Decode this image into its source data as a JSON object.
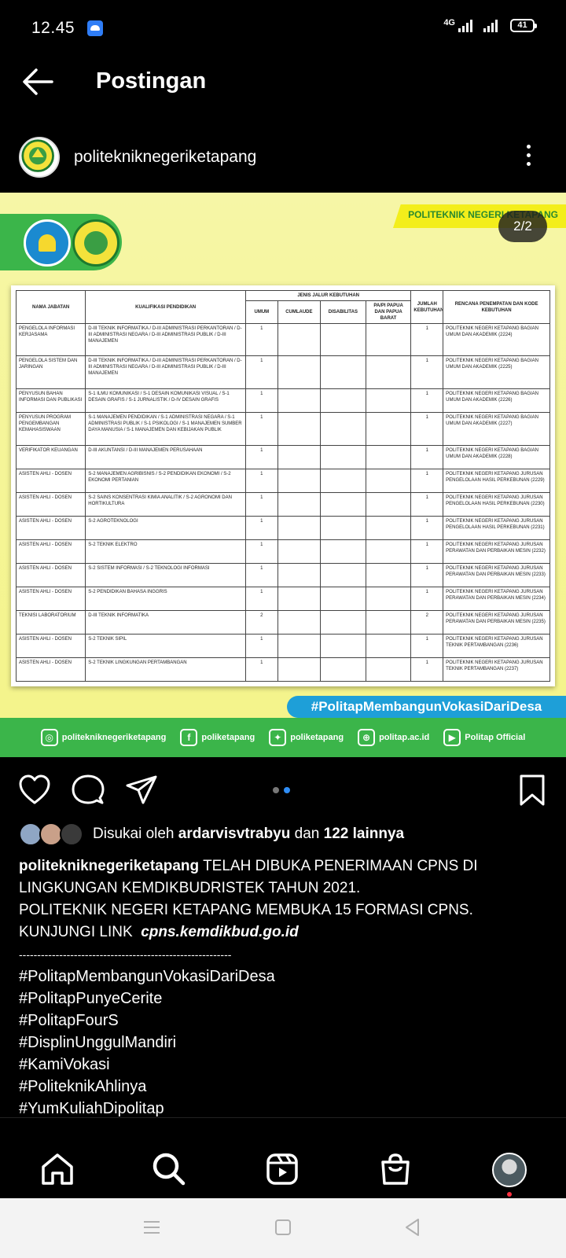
{
  "status_bar": {
    "time": "12.45",
    "network": "4G",
    "battery": "41"
  },
  "header": {
    "title": "Postingan"
  },
  "account": {
    "username": "politekniknegeriketapang"
  },
  "post": {
    "brand_label": "POLITEKNIK NEGERI KETAPANG",
    "page_counter": "2/2",
    "hashtag_banner": "#PolitapMembangunVokasiDariDesa",
    "social_links": [
      {
        "icon": "instagram-icon",
        "glyph": "◎",
        "label": "politekniknegeriketapang"
      },
      {
        "icon": "facebook-icon",
        "glyph": "f",
        "label": "poliketapang"
      },
      {
        "icon": "twitter-icon",
        "glyph": "✦",
        "label": "poliketapang"
      },
      {
        "icon": "globe-icon",
        "glyph": "⊕",
        "label": "politap.ac.id"
      },
      {
        "icon": "youtube-icon",
        "glyph": "▶",
        "label": "Politap Official"
      }
    ],
    "table": {
      "headers": {
        "jabatan": "NAMA JABATAN",
        "kualifikasi": "KUALIFIKASI PENDIDIKAN",
        "jenis": "JENIS JALUR KEBUTUHAN",
        "umum": "UMUM",
        "cumlaude": "CUMLAUDE",
        "disabilitas": "DISABILITAS",
        "papua": "PA/PI PAPUA DAN PAPUA BARAT",
        "jumlah": "JUMLAH KEBUTUHAN",
        "rencana": "RENCANA PENEMPATAN DAN KODE KEBUTUHAN"
      },
      "rows": [
        {
          "jabatan": "PENGELOLA INFORMASI KERJASAMA",
          "kualifikasi": "D-III TEKNIK INFORMATIKA / D-III ADMINISTRASI PERKANTORAN / D-III ADMINISTRASI NEGARA / D-III ADMINISTRASI PUBLIK / D-III MANAJEMEN",
          "umum": "1",
          "jumlah": "1",
          "rencana": "POLITEKNIK NEGERI KETAPANG BAGIAN UMUM DAN AKADEMIK (2224)"
        },
        {
          "jabatan": "PENGELOLA SISTEM DAN JARINGAN",
          "kualifikasi": "D-III TEKNIK INFORMATIKA / D-III ADMINISTRASI PERKANTORAN / D-III ADMINISTRASI NEGARA / D-III ADMINISTRASI PUBLIK / D-III MANAJEMEN",
          "umum": "1",
          "jumlah": "1",
          "rencana": "POLITEKNIK NEGERI KETAPANG BAGIAN UMUM DAN AKADEMIK (2225)"
        },
        {
          "jabatan": "PENYUSUN BAHAN INFORMASI DAN PUBLIKASI",
          "kualifikasi": "S-1 ILMU KOMUNIKASI / S-1 DESAIN KOMUNIKASI VISUAL / S-1 DESAIN GRAFIS / S-1 JURNALISTIK / D-IV DESAIN GRAFIS",
          "umum": "1",
          "jumlah": "1",
          "rencana": "POLITEKNIK NEGERI KETAPANG BAGIAN UMUM DAN AKADEMIK (2226)"
        },
        {
          "jabatan": "PENYUSUN PROGRAM PENGEMBANGAN KEMAHASISWAAN",
          "kualifikasi": "S-1 MANAJEMEN PENDIDIKAN / S-1 ADMINISTRASI NEGARA / S-1 ADMINISTRASI PUBLIK / S-1 PSIKOLOGI / S-1 MANAJEMEN SUMBER DAYA MANUSIA / S-1 MANAJEMEN DAN KEBIJAKAN PUBLIK",
          "umum": "1",
          "jumlah": "1",
          "rencana": "POLITEKNIK NEGERI KETAPANG BAGIAN UMUM DAN AKADEMIK (2227)"
        },
        {
          "jabatan": "VERIFIKATOR KEUANGAN",
          "kualifikasi": "D-III AKUNTANSI / D-III MANAJEMEN PERUSAHAAN",
          "umum": "1",
          "jumlah": "1",
          "rencana": "POLITEKNIK NEGERI KETAPANG BAGIAN UMUM DAN AKADEMIK (2228)"
        },
        {
          "jabatan": "ASISTEN AHLI - DOSEN",
          "kualifikasi": "S-2 MANAJEMEN AGRIBISNIS / S-2 PENDIDIKAN EKONOMI / S-2 EKONOMI PERTANIAN",
          "umum": "1",
          "jumlah": "1",
          "rencana": "POLITEKNIK NEGERI KETAPANG JURUSAN PENGELOLAAN HASIL PERKEBUNAN (2229)"
        },
        {
          "jabatan": "ASISTEN AHLI - DOSEN",
          "kualifikasi": "S-2 SAINS KONSENTRASI KIMIA ANALITIK / S-2 AGRONOMI DAN HORTIKULTURA",
          "umum": "1",
          "jumlah": "1",
          "rencana": "POLITEKNIK NEGERI KETAPANG JURUSAN PENGELOLAAN HASIL PERKEBUNAN (2230)"
        },
        {
          "jabatan": "ASISTEN AHLI - DOSEN",
          "kualifikasi": "S-2 AGROTEKNOLOGI",
          "umum": "1",
          "jumlah": "1",
          "rencana": "POLITEKNIK NEGERI KETAPANG JURUSAN PENGELOLAAN HASIL PERKEBUNAN (2231)"
        },
        {
          "jabatan": "ASISTEN AHLI - DOSEN",
          "kualifikasi": "S-2 TEKNIK ELEKTRO",
          "umum": "1",
          "jumlah": "1",
          "rencana": "POLITEKNIK NEGERI KETAPANG JURUSAN PERAWATAN DAN PERBAIKAN MESIN (2232)"
        },
        {
          "jabatan": "ASISTEN AHLI - DOSEN",
          "kualifikasi": "S-2 SISTEM INFORMASI / S-2 TEKNOLOGI INFORMASI",
          "umum": "1",
          "jumlah": "1",
          "rencana": "POLITEKNIK NEGERI KETAPANG JURUSAN PERAWATAN DAN PERBAIKAN MESIN (2233)"
        },
        {
          "jabatan": "ASISTEN AHLI - DOSEN",
          "kualifikasi": "S-2 PENDIDIKAN BAHASA INGGRIS",
          "umum": "1",
          "jumlah": "1",
          "rencana": "POLITEKNIK NEGERI KETAPANG JURUSAN PERAWATAN DAN PERBAIKAN MESIN (2234)"
        },
        {
          "jabatan": "TEKNISI LABORATORIUM",
          "kualifikasi": "D-III TEKNIK INFORMATIKA",
          "umum": "2",
          "jumlah": "2",
          "rencana": "POLITEKNIK NEGERI KETAPANG JURUSAN PERAWATAN DAN PERBAIKAN MESIN (2235)"
        },
        {
          "jabatan": "ASISTEN AHLI - DOSEN",
          "kualifikasi": "S-2 TEKNIK SIPIL",
          "umum": "1",
          "jumlah": "1",
          "rencana": "POLITEKNIK NEGERI KETAPANG JURUSAN TEKNIK PERTAMBANGAN (2236)"
        },
        {
          "jabatan": "ASISTEN AHLI - DOSEN",
          "kualifikasi": "S-2 TEKNIK LINGKUNGAN PERTAMBANGAN",
          "umum": "1",
          "jumlah": "1",
          "rencana": "POLITEKNIK NEGERI KETAPANG JURUSAN TEKNIK PERTAMBANGAN (2237)"
        }
      ]
    }
  },
  "likes": {
    "prefix": "Disukai oleh",
    "user": "ardarvisvtrabyu",
    "middle": "dan",
    "count": "122 lainnya"
  },
  "caption": {
    "username": "politekniknegeriketapang",
    "line1": "TELAH DIBUKA PENERIMAAN CPNS DI",
    "line2": "LINGKUNGAN KEMDIKBUDRISTEK TAHUN 2021.",
    "line3": "POLITEKNIK NEGERI KETAPANG MEMBUKA 15 FORMASI CPNS.",
    "link_prefix": "KUNJUNGI LINK",
    "link": "cpns.kemdikbud.go.id",
    "separator": "----------------------------------------------------------",
    "hashtags": [
      "#PolitapMembangunVokasiDariDesa",
      "#PolitapPunyeCerite",
      "#PolitapFourS",
      "#DisplinUnggulMandiri",
      "#KamiVokasi",
      "#PoliteknikAhlinya",
      "#YumKuliahDipolitap"
    ]
  },
  "colors": {
    "background": "#000000",
    "post_yellow": "#f4f489",
    "brand_green": "#3bb54a",
    "hashtag_blue": "#1e9fd8",
    "active_dot": "#2f8df6"
  }
}
